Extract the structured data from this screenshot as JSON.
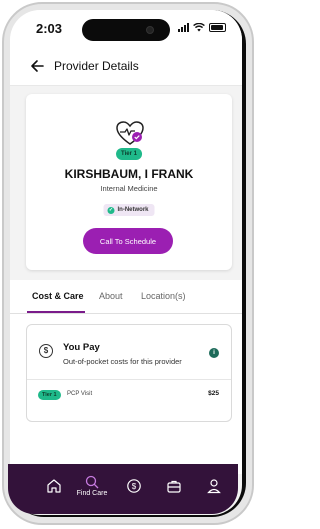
{
  "status_bar": {
    "time": "2:03"
  },
  "header": {
    "title": "Provider Details"
  },
  "provider": {
    "tier": "Tier 1",
    "name": "KIRSHBAUM, I FRANK",
    "specialty": "Internal Medicine",
    "network": "In-Network",
    "schedule_button": "Call To Schedule"
  },
  "tabs": [
    {
      "label": "Cost & Care",
      "active": true
    },
    {
      "label": "About",
      "active": false
    },
    {
      "label": "Location(s)",
      "active": false
    }
  ],
  "cost": {
    "title": "You Pay",
    "subtitle": "Out-of-pocket costs for this provider",
    "rows": [
      {
        "tier": "Tier 1",
        "label": "PCP Visit",
        "amount": "$25"
      }
    ]
  },
  "bottom_nav": {
    "items": [
      {
        "icon": "home-icon",
        "label": ""
      },
      {
        "icon": "search-icon",
        "label": "Find Care"
      },
      {
        "icon": "dollar-icon",
        "label": ""
      },
      {
        "icon": "briefcase-icon",
        "label": ""
      },
      {
        "icon": "person-icon",
        "label": ""
      }
    ]
  },
  "colors": {
    "accent": "#9b1fb2",
    "tier_green": "#1fb98a",
    "nav_background": "#33123a",
    "tab_underline": "#7a1b8a"
  }
}
